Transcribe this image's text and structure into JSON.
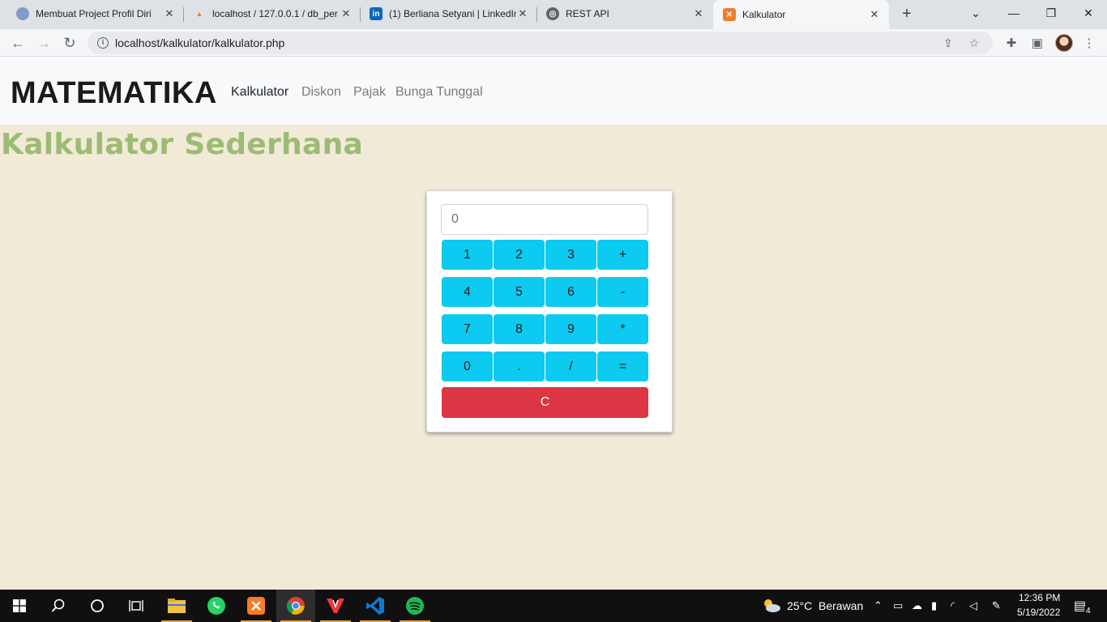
{
  "browser": {
    "tabs": [
      {
        "title": "Membuat Project Profil Diri",
        "icon": "profile-icon",
        "active": false
      },
      {
        "title": "localhost / 127.0.0.1 / db_per",
        "icon": "phpmyadmin-icon",
        "active": false
      },
      {
        "title": "(1) Berliana Setyani | LinkedIn",
        "icon": "linkedin-icon",
        "active": false
      },
      {
        "title": "REST API",
        "icon": "globe-icon",
        "active": false
      },
      {
        "title": "Kalkulator",
        "icon": "xampp-icon",
        "active": true
      }
    ],
    "url": "localhost/kalkulator/kalkulator.php"
  },
  "navbar": {
    "brand": "MATEMATIKA",
    "links": [
      {
        "label": "Kalkulator",
        "active": true
      },
      {
        "label": "Diskon",
        "active": false
      },
      {
        "label": "Pajak",
        "active": false
      },
      {
        "label": "Bunga Tunggal",
        "active": false
      }
    ]
  },
  "page": {
    "heading": "Kalkulator Sederhana"
  },
  "calculator": {
    "display_value": "0",
    "keys": [
      [
        "1",
        "2",
        "3",
        "+"
      ],
      [
        "4",
        "5",
        "6",
        "-"
      ],
      [
        "7",
        "8",
        "9",
        "*"
      ],
      [
        "0",
        ".",
        "/",
        "="
      ]
    ],
    "clear_label": "C"
  },
  "taskbar": {
    "weather_temp": "25°C",
    "weather_desc": "Berawan",
    "time": "12:36 PM",
    "date": "5/19/2022",
    "notification_count": "4"
  },
  "colors": {
    "accent_cyan": "#0dcaf0",
    "danger": "#dc3545",
    "heading_green": "#9cbb75",
    "page_bg": "#f0ead6"
  }
}
